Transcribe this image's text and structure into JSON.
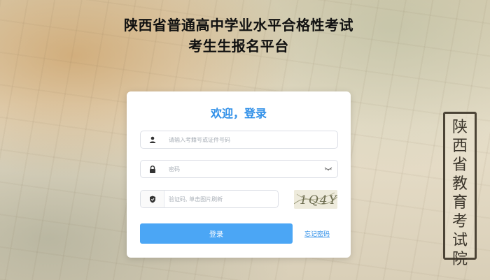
{
  "header": {
    "title_line1": "陕西省普通高中学业水平合格性考试",
    "title_line2": "考生生报名平台"
  },
  "background": {
    "board_text": "陕西省教育考试院"
  },
  "login": {
    "heading": "欢迎，登录",
    "username_placeholder": "请输入考籍号或证件号码",
    "password_placeholder": "密码",
    "captcha_placeholder": "验证码, 单击图片刷新",
    "captcha_text": "1Q4Y",
    "submit_label": "登录",
    "forgot_label": "忘记密码"
  },
  "icons": {
    "username": "user-icon",
    "password": "lock-icon",
    "captcha": "shield-icon",
    "visibility": "eye-closed-icon"
  },
  "colors": {
    "accent": "#2f8fe8",
    "button": "#4ba6f5"
  }
}
